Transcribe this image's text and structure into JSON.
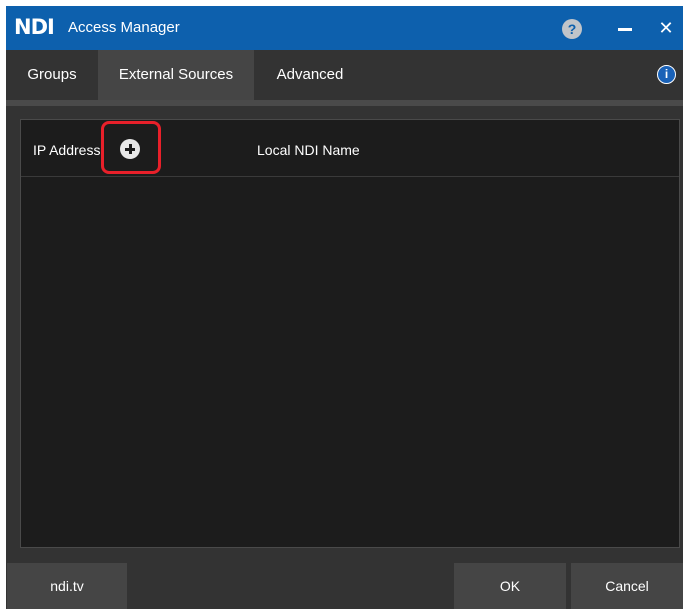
{
  "titlebar": {
    "logo": "NDI",
    "title": "Access Manager",
    "help_icon": "question-mark-icon",
    "help_glyph": "?",
    "minimize_icon": "minimize-icon",
    "close_icon": "close-icon",
    "close_glyph": "✕"
  },
  "tabs": [
    {
      "label": "Groups",
      "active": false
    },
    {
      "label": "External Sources",
      "active": true
    },
    {
      "label": "Advanced",
      "active": false
    }
  ],
  "info": {
    "icon": "info-icon",
    "glyph": "i"
  },
  "table": {
    "columns": {
      "ip_address": "IP Address",
      "local_name": "Local NDI Name"
    },
    "add_icon": "plus-circle-icon",
    "rows": []
  },
  "footer": {
    "link_label": "ndi.tv",
    "ok_label": "OK",
    "cancel_label": "Cancel"
  },
  "colors": {
    "titlebar": "#0d60ad",
    "window_bg": "#333333",
    "active_tab": "#454545",
    "table_bg": "#1c1c1c",
    "highlight": "#e8202a"
  }
}
